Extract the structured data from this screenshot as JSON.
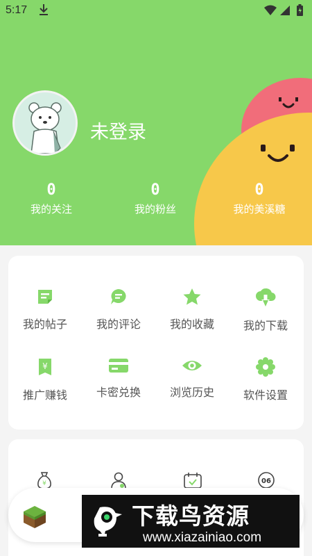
{
  "status_bar": {
    "time": "5:17",
    "icons": [
      "download-icon",
      "wifi-icon",
      "signal-icon",
      "battery-icon"
    ]
  },
  "profile": {
    "login_label": "未登录",
    "avatar": "bear-avatar"
  },
  "stats": [
    {
      "count": "0",
      "label": "我的关注"
    },
    {
      "count": "0",
      "label": "我的粉丝"
    },
    {
      "count": "0",
      "label": "我的美溪糖"
    }
  ],
  "menu": [
    {
      "label": "我的帖子",
      "icon": "post-icon"
    },
    {
      "label": "我的评论",
      "icon": "comment-icon"
    },
    {
      "label": "我的收藏",
      "icon": "star-icon"
    },
    {
      "label": "我的下载",
      "icon": "download-cloud-icon"
    },
    {
      "label": "推广赚钱",
      "icon": "money-icon"
    },
    {
      "label": "卡密兑换",
      "icon": "card-icon"
    },
    {
      "label": "浏览历史",
      "icon": "eye-icon"
    },
    {
      "label": "软件设置",
      "icon": "gear-icon"
    }
  ],
  "secondary_menu_icons": [
    "money-bag-icon",
    "user-icon",
    "calendar-check-icon",
    "badge-06-icon"
  ],
  "badge_text": "06",
  "watermark": {
    "title": "下载鸟资源",
    "url": "www.xiazainiao.com"
  },
  "colors": {
    "header_green": "#86d86a",
    "icon_green": "#86d86a",
    "blob_pink": "#f16d7a",
    "blob_yellow": "#f7c84a"
  }
}
